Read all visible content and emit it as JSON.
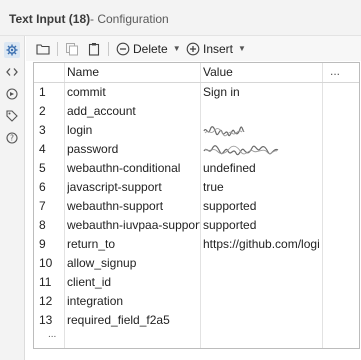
{
  "title": {
    "main": "Text Input (18)",
    "sub": "- Configuration"
  },
  "sidebar": {
    "icons": [
      "gear-icon",
      "code-icon",
      "pin-icon",
      "tag-icon",
      "help-icon"
    ]
  },
  "toolbar": {
    "delete_label": "Delete",
    "insert_label": "Insert"
  },
  "table": {
    "columns": [
      "Name",
      "Value"
    ],
    "more_label": "...",
    "rows": [
      {
        "num": "1",
        "name": "commit",
        "value": "Sign in"
      },
      {
        "num": "2",
        "name": "add_account",
        "value": ""
      },
      {
        "num": "3",
        "name": "login",
        "value": ""
      },
      {
        "num": "4",
        "name": "password",
        "value": ""
      },
      {
        "num": "5",
        "name": "webauthn-conditional",
        "value": "undefined"
      },
      {
        "num": "6",
        "name": "javascript-support",
        "value": "true"
      },
      {
        "num": "7",
        "name": "webauthn-support",
        "value": "supported"
      },
      {
        "num": "8",
        "name": "webauthn-iuvpaa-support",
        "value": "supported"
      },
      {
        "num": "9",
        "name": "return_to",
        "value": "https://github.com/login"
      },
      {
        "num": "10",
        "name": "allow_signup",
        "value": ""
      },
      {
        "num": "11",
        "name": "client_id",
        "value": ""
      },
      {
        "num": "12",
        "name": "integration",
        "value": ""
      },
      {
        "num": "13",
        "name": "required_field_f2a5",
        "value": ""
      }
    ],
    "new_row_marker": "..."
  }
}
